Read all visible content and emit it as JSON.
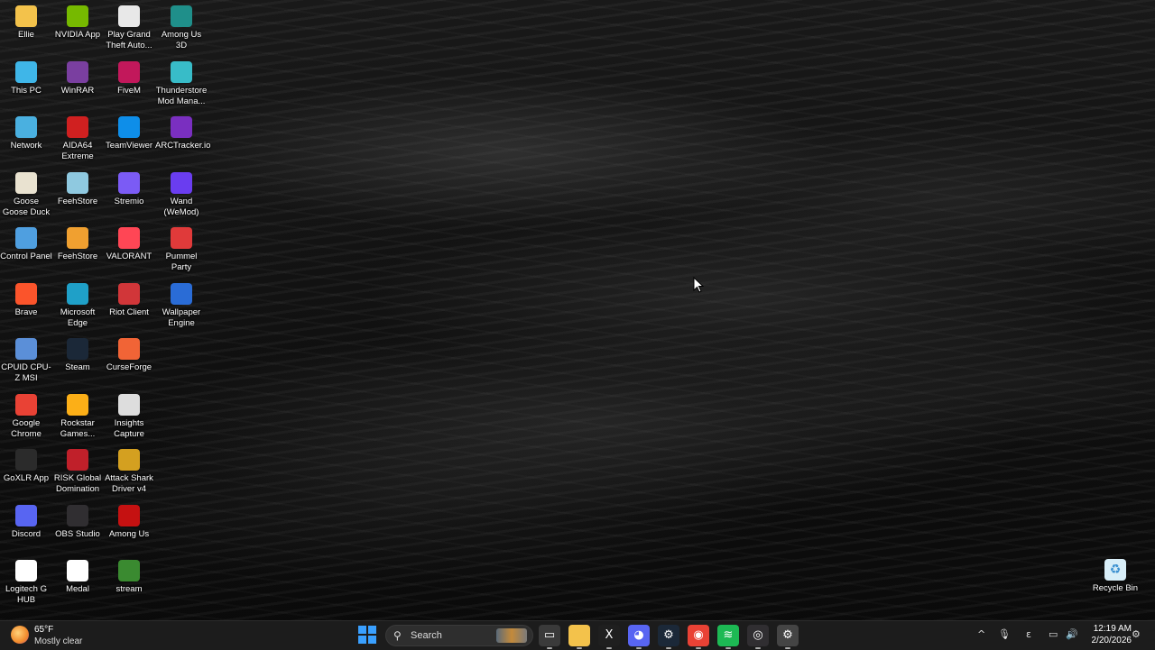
{
  "desktop": {
    "icons": [
      {
        "label": "Ellie",
        "icon": "folder-icon",
        "color": "#f3c24b"
      },
      {
        "label": "This PC",
        "icon": "monitor-icon",
        "color": "#3fb6e8"
      },
      {
        "label": "Network",
        "icon": "network-icon",
        "color": "#4ab0e0"
      },
      {
        "label": "Goose Goose Duck",
        "icon": "goose-icon",
        "color": "#e9e2d0"
      },
      {
        "label": "Control Panel",
        "icon": "control-panel-icon",
        "color": "#4f9fe0"
      },
      {
        "label": "Brave",
        "icon": "brave-icon",
        "color": "#fb542b"
      },
      {
        "label": "CPUID CPU-Z MSI",
        "icon": "cpuz-icon",
        "color": "#5b8fd8"
      },
      {
        "label": "Google Chrome",
        "icon": "chrome-icon",
        "color": "#e94235"
      },
      {
        "label": "GoXLR App",
        "icon": "goxlr-icon",
        "color": "#2b2b2b"
      },
      {
        "label": "Discord",
        "icon": "discord-icon",
        "color": "#5865f2"
      },
      {
        "label": "Logitech G HUB",
        "icon": "logitech-icon",
        "color": "#ffffff"
      },
      {
        "label": "NVIDIA App",
        "icon": "nvidia-icon",
        "color": "#76b900"
      },
      {
        "label": "WinRAR",
        "icon": "winrar-icon",
        "color": "#7a3fa0"
      },
      {
        "label": "AIDA64 Extreme",
        "icon": "aida64-icon",
        "color": "#d02020"
      },
      {
        "label": "FeehStore",
        "icon": "disc-icon",
        "color": "#8fc9e0"
      },
      {
        "label": "FeehStore",
        "icon": "shield-icon",
        "color": "#f0a030"
      },
      {
        "label": "Microsoft Edge",
        "icon": "edge-icon",
        "color": "#1fa0c8"
      },
      {
        "label": "Steam",
        "icon": "steam-icon",
        "color": "#1b2838"
      },
      {
        "label": "Rockstar Games...",
        "icon": "rockstar-icon",
        "color": "#fcaf17"
      },
      {
        "label": "RISK Global Domination",
        "icon": "risk-icon",
        "color": "#c0202a"
      },
      {
        "label": "OBS Studio",
        "icon": "obs-icon",
        "color": "#302e31"
      },
      {
        "label": "Medal",
        "icon": "medal-icon",
        "color": "#ffffff"
      },
      {
        "label": "Play Grand Theft Auto...",
        "icon": "gta-icon",
        "color": "#e8e8e8"
      },
      {
        "label": "FiveM",
        "icon": "fivem-icon",
        "color": "#c2185b"
      },
      {
        "label": "TeamViewer",
        "icon": "teamviewer-icon",
        "color": "#0e8ee9"
      },
      {
        "label": "Stremio",
        "icon": "stremio-icon",
        "color": "#7b5bf5"
      },
      {
        "label": "VALORANT",
        "icon": "valorant-icon",
        "color": "#ff4655"
      },
      {
        "label": "Riot Client",
        "icon": "riot-icon",
        "color": "#d13639"
      },
      {
        "label": "CurseForge",
        "icon": "curseforge-icon",
        "color": "#f16436"
      },
      {
        "label": "Insights Capture",
        "icon": "insights-icon",
        "color": "#dddddd"
      },
      {
        "label": "Attack Shark Driver v4",
        "icon": "attack-shark-icon",
        "color": "#d4a020"
      },
      {
        "label": "Among Us",
        "icon": "among-us-icon",
        "color": "#c51111"
      },
      {
        "label": "stream",
        "icon": "stream-icon",
        "color": "#3a8a30"
      },
      {
        "label": "Among Us 3D",
        "icon": "among-us-3d-icon",
        "color": "#1f8f8a"
      },
      {
        "label": "Thunderstore Mod Mana...",
        "icon": "thunderstore-icon",
        "color": "#38bcc8"
      },
      {
        "label": "ARCTracker.io",
        "icon": "arctracker-icon",
        "color": "#7a2fc0"
      },
      {
        "label": "Wand (WeMod)",
        "icon": "wand-icon",
        "color": "#6a3df0"
      },
      {
        "label": "Pummel Party",
        "icon": "pummel-party-icon",
        "color": "#e03a3a"
      },
      {
        "label": "Wallpaper Engine",
        "icon": "wallpaper-engine-icon",
        "color": "#2a6cd6"
      }
    ],
    "recycle_bin": {
      "label": "Recycle Bin",
      "icon": "recycle-bin-icon"
    }
  },
  "taskbar": {
    "weather": {
      "temp": "65°F",
      "condition": "Mostly clear",
      "icon": "weather-moon-cloud-icon"
    },
    "search_label": "Search",
    "apps": [
      {
        "name": "task-view",
        "icon": "task-view-icon",
        "glyph": "▭",
        "color": "#3a3a3a"
      },
      {
        "name": "file-explorer",
        "icon": "folder-icon",
        "glyph": "",
        "color": "#f3c24b"
      },
      {
        "name": "excel",
        "icon": "excel-icon",
        "glyph": "X",
        "color": "#1f1f1f"
      },
      {
        "name": "discord",
        "icon": "discord-icon",
        "glyph": "◕",
        "color": "#5865f2"
      },
      {
        "name": "steam",
        "icon": "steam-icon",
        "glyph": "⚙",
        "color": "#1b2838"
      },
      {
        "name": "chrome",
        "icon": "chrome-icon",
        "glyph": "◉",
        "color": "#e94235"
      },
      {
        "name": "spotify",
        "icon": "spotify-icon",
        "glyph": "≋",
        "color": "#1db954"
      },
      {
        "name": "obs",
        "icon": "obs-icon",
        "glyph": "◎",
        "color": "#302e31"
      },
      {
        "name": "settings",
        "icon": "gear-icon",
        "glyph": "⚙",
        "color": "#444"
      }
    ],
    "tray": {
      "chevron": "^",
      "mic": "🎙",
      "ime": "ε"
    },
    "clock": {
      "time": "12:19 AM",
      "date": "2/20/2026"
    }
  }
}
